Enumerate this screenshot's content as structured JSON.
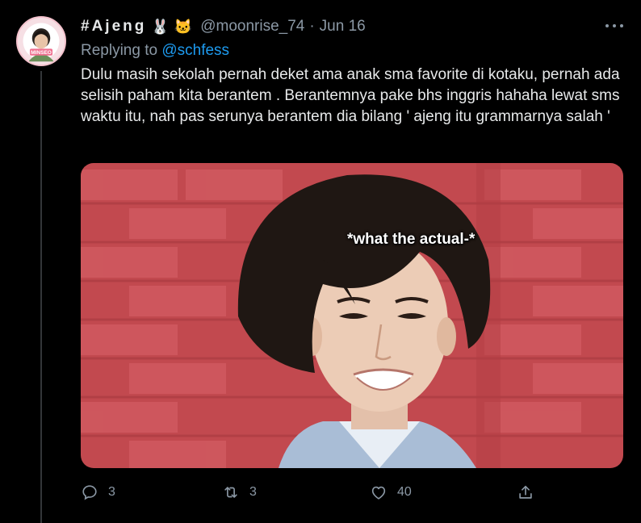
{
  "tweet": {
    "display_name": "#Ajeng",
    "emoji_1": "🐰",
    "emoji_2": "🐱",
    "handle": "@moonrise_74",
    "separator": "·",
    "date": "Jun 16",
    "replying_prefix": "Replying to",
    "replying_to": "@schfess",
    "text": "Dulu masih sekolah pernah deket ama anak sma favorite di kotaku, pernah ada selisih paham kita berantem . Berantemnya pake bhs inggris hahaha lewat sms waktu itu, nah pas serunya berantem dia bilang ' ajeng itu grammarnya salah '",
    "media_caption": "*what the actual-*",
    "avatar_text": "MINSEO"
  },
  "actions": {
    "reply_count": "3",
    "retweet_count": "3",
    "like_count": "40"
  },
  "icons": [
    "more-icon",
    "reply-icon",
    "retweet-icon",
    "like-icon",
    "share-icon"
  ],
  "colors": {
    "background": "#000000",
    "text": "#e7e9ea",
    "secondary": "#8b98a5",
    "link": "#1d9bf0"
  }
}
